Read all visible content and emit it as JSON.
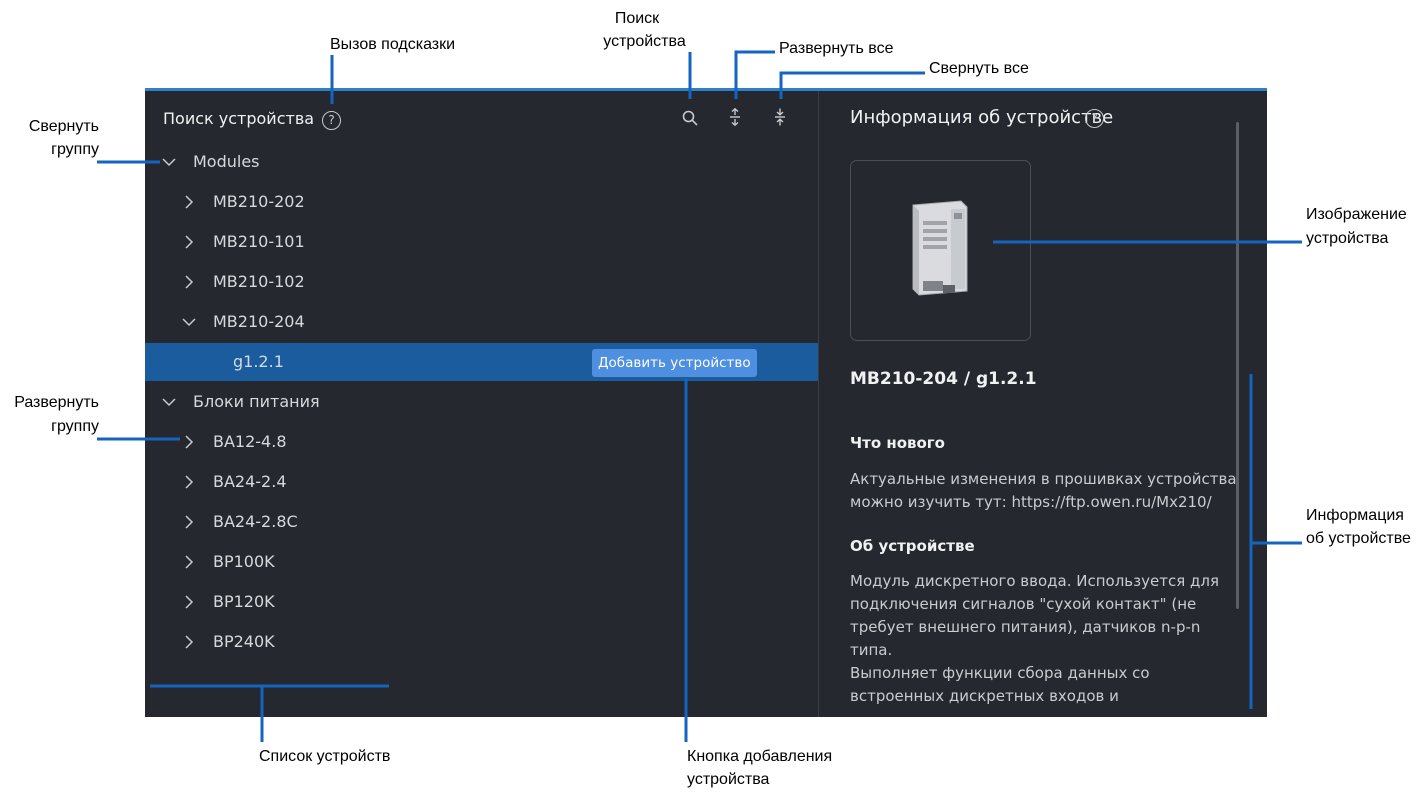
{
  "annotations": {
    "help_call": "Вызов подсказки",
    "device_search": [
      "Поиск",
      "устройства"
    ],
    "expand_all": "Развернуть все",
    "collapse_all": "Свернуть все",
    "collapse_group": [
      "Свернуть",
      "группу"
    ],
    "expand_group": [
      "Развернуть",
      "группу"
    ],
    "device_image": [
      "Изображение",
      "устройства"
    ],
    "device_info": [
      "Информация",
      "об устройстве"
    ],
    "device_list": "Список устройств",
    "add_button_caption": [
      "Кнопка добавления",
      "устройства"
    ]
  },
  "colors": {
    "accent": "#2f80c8",
    "selected_row": "#1a5c9e",
    "add_button": "#4e8fe0",
    "window_bg": "#25282e",
    "annotation_line": "#1565c0"
  },
  "left_pane": {
    "title": "Поиск устройства",
    "help_icon": "question-circle-icon",
    "toolbar": [
      "search-icon",
      "expand-all-icon",
      "collapse-all-icon"
    ],
    "tree": [
      {
        "label": "Modules",
        "level": 0,
        "expanded": true
      },
      {
        "label": "MB210-202",
        "level": 1,
        "expanded": false
      },
      {
        "label": "MB210-101",
        "level": 1,
        "expanded": false
      },
      {
        "label": "MB210-102",
        "level": 1,
        "expanded": false
      },
      {
        "label": "MB210-204",
        "level": 1,
        "expanded": true
      },
      {
        "label": "g1.2.1",
        "level": 2,
        "selected": true
      },
      {
        "label": "Блоки питания",
        "level": 0,
        "expanded": true
      },
      {
        "label": "BA12-4.8",
        "level": 1,
        "expanded": false
      },
      {
        "label": "BA24-2.4",
        "level": 1,
        "expanded": false
      },
      {
        "label": "BA24-2.8C",
        "level": 1,
        "expanded": false
      },
      {
        "label": "BP100K",
        "level": 1,
        "expanded": false
      },
      {
        "label": "BP120K",
        "level": 1,
        "expanded": false
      },
      {
        "label": "BP240K",
        "level": 1,
        "expanded": false
      }
    ],
    "add_button_label": "Добавить устройство"
  },
  "right_pane": {
    "title": "Информация об устройстве",
    "device_name": "MB210-204 / g1.2.1",
    "whats_new_heading": "Что нового",
    "whats_new_text": "Актуальные изменения в прошивках устройства\nможно изучить тут: https://ftp.owen.ru/Mx210/",
    "about_heading": "Об устройстве",
    "about_text": "Модуль дискретного ввода. Используется для\nподключения сигналов \"сухой контакт\" (не\nтребует внешнего питания), датчиков n-p-n\nтипа.\nВыполняет функции сбора данных со\nвстроенных дискретных входов и"
  }
}
